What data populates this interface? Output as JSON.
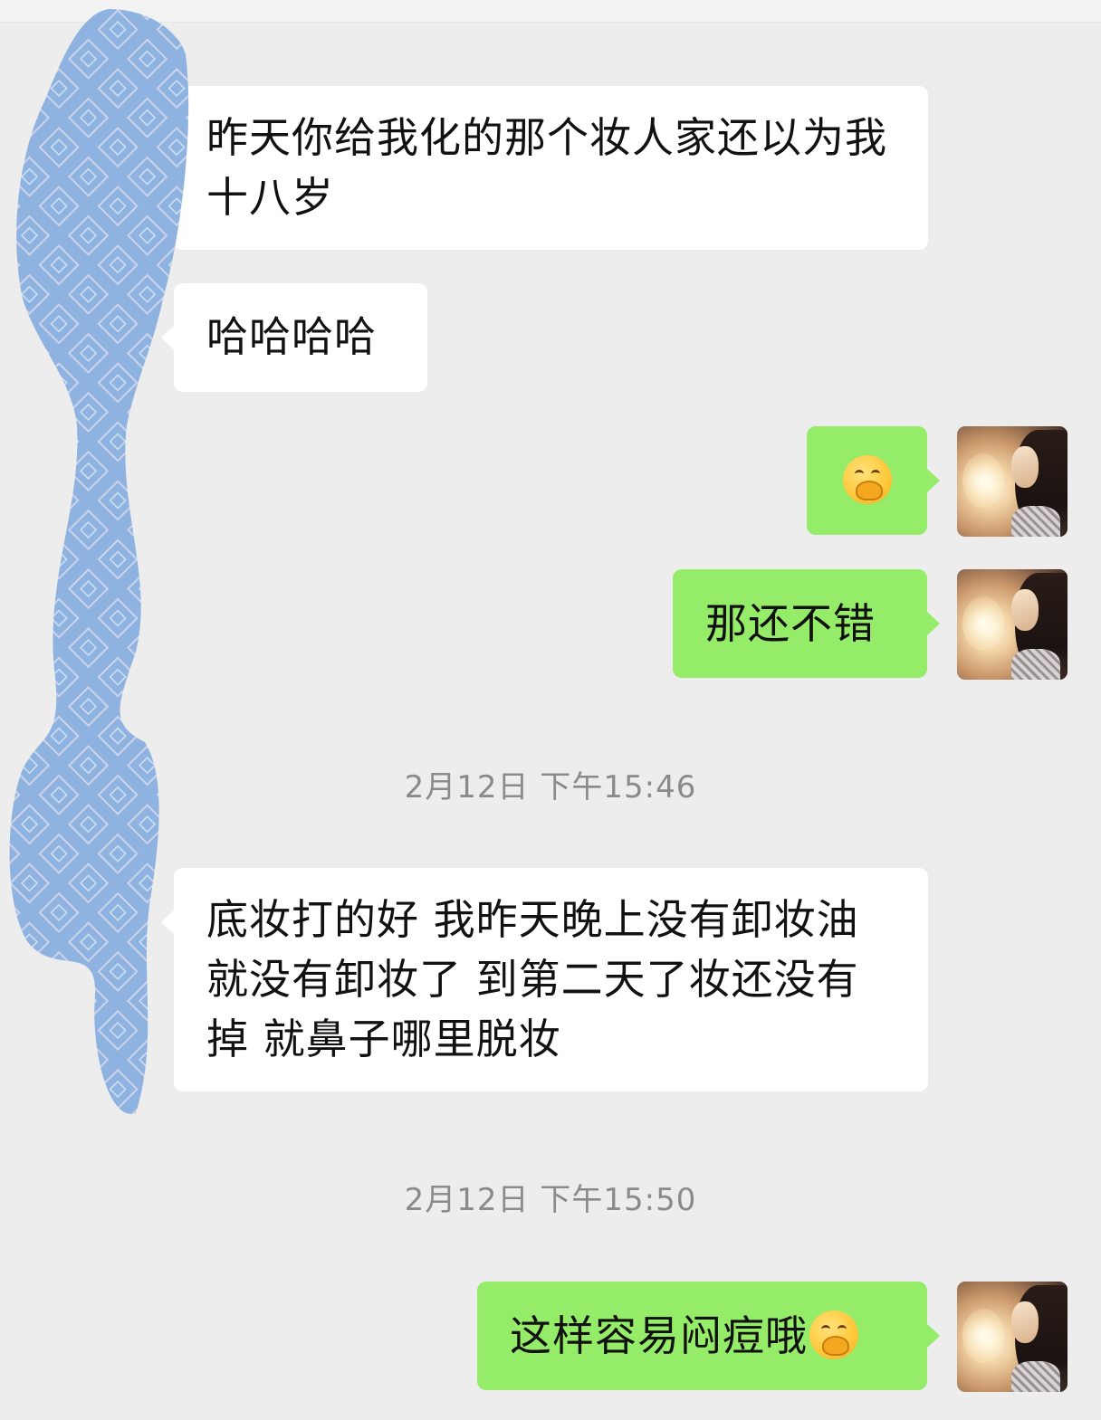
{
  "chat": {
    "messages": [
      {
        "id": "m1",
        "side": "received",
        "text": "昨天你给我化的那个妆人家还以为我十八岁"
      },
      {
        "id": "m2",
        "side": "received",
        "text": "哈哈哈哈"
      },
      {
        "id": "m3",
        "side": "sent",
        "emoji": "face-with-hand-over-mouth-icon"
      },
      {
        "id": "m4",
        "side": "sent",
        "text": "那还不错"
      },
      {
        "id": "m5",
        "side": "received",
        "text": "底妆打的好 我昨天晚上没有卸妆油就没有卸妆了 到第二天了妆还没有掉 就鼻子哪里脱妆"
      },
      {
        "id": "m6",
        "side": "sent",
        "text": "这样容易闷痘哦",
        "emoji": "face-with-hand-over-mouth-icon"
      }
    ],
    "timestamps": [
      {
        "text": "2月12日 下午15:46"
      },
      {
        "text": "2月12日 下午15:50"
      }
    ]
  },
  "colors": {
    "background": "#ededed",
    "received_bubble": "#ffffff",
    "sent_bubble": "#95ec69",
    "timestamp_text": "#8a8a8a",
    "privacy_scribble": "#8fb3e0"
  }
}
